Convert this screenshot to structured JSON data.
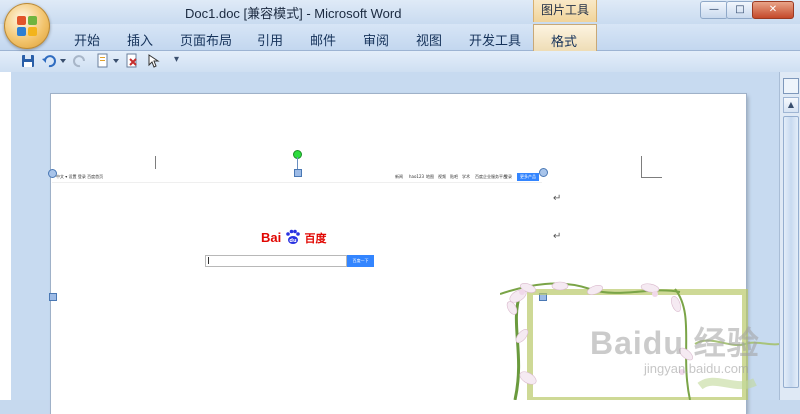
{
  "titlebar": {
    "window_title": "Doc1.doc [兼容模式] - Microsoft Word",
    "context_tab_group": "图片工具",
    "minimize": "—",
    "maximize": "□",
    "close": "✕"
  },
  "ribbon": {
    "tabs": [
      "开始",
      "插入",
      "页面布局",
      "引用",
      "邮件",
      "审阅",
      "视图",
      "开发工具",
      "格式"
    ],
    "help": "?"
  },
  "quick_access": {
    "icons": [
      "save-icon",
      "undo-icon",
      "redo-icon",
      "new-document-icon",
      "print-preview-icon",
      "select-icon",
      "customize-icon"
    ]
  },
  "document": {
    "paragraph_mark": "↵"
  },
  "baidu_screenshot": {
    "nav_left": "中文 ▾ 设置  登录  百度首页",
    "nav_right": [
      "新闻",
      "hao123",
      "地图",
      "视频",
      "贴吧",
      "学术",
      "百度企业服务平台",
      "登录"
    ],
    "settings_button": "更多产品",
    "logo_text_1": "Bai",
    "logo_text_2": "du",
    "logo_text_3": "百度",
    "search_button": "百度一下"
  },
  "watermark": {
    "main": "Baidu 经验",
    "sub": "jingyan.baidu.com"
  },
  "colors": {
    "accent_blue": "#3385ff",
    "baidu_red": "#e10601",
    "baidu_blue": "#2932e1"
  }
}
